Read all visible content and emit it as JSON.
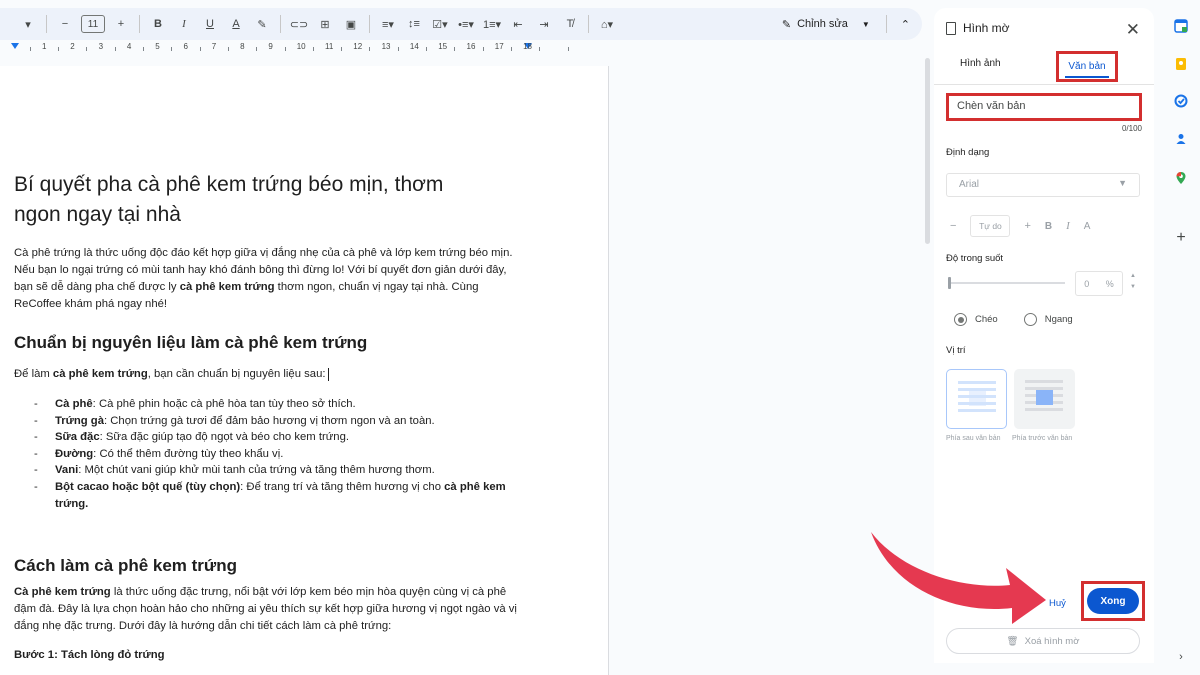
{
  "toolbar": {
    "font_size": "11",
    "edit_mode_label": "Chỉnh sửa"
  },
  "ruler": {
    "numbers": [
      "1",
      "2",
      "3",
      "4",
      "5",
      "6",
      "7",
      "8",
      "9",
      "10",
      "11",
      "12",
      "13",
      "14",
      "15",
      "16",
      "17",
      "18"
    ]
  },
  "document": {
    "title": "Bí quyết pha cà phê kem trứng béo mịn, thơm ngon ngay tại nhà",
    "intro_text": "Cà phê trứng là thức uống độc đáo kết hợp giữa vị đắng nhẹ của cà phê và lớp kem trứng béo mịn. Nếu bạn lo ngại trứng có mùi tanh hay khó đánh bông thì đừng lo! Với bí quyết đơn giản dưới đây, bạn sẽ dễ dàng pha chế được ly ",
    "intro_bold": "cà phê kem trứng",
    "intro_tail": " thơm ngon, chuẩn vị ngay tại nhà. Cùng ReCoffee khám phá ngay nhé!",
    "section1_heading": "Chuẩn bị nguyên liệu làm cà phê kem trứng",
    "section1_lead_pre": "Để làm ",
    "section1_lead_bold": "cà phê kem trứng",
    "section1_lead_post": ", bạn cần chuẩn bị nguyên liệu sau:",
    "ingredients": [
      {
        "name": "Cà phê",
        "desc": ": Cà phê phin hoặc cà phê hòa tan tùy theo sở thích."
      },
      {
        "name": "Trứng gà",
        "desc": ": Chọn trứng gà tươi để đảm bảo hương vị thơm ngon và an toàn."
      },
      {
        "name": "Sữa đặc",
        "desc": ": Sữa đặc giúp tạo độ ngọt và béo cho kem trứng."
      },
      {
        "name": "Đường",
        "desc": ": Có thể thêm đường tùy theo khẩu vị."
      },
      {
        "name": "Vani",
        "desc": ": Một chút vani giúp khử mùi tanh của trứng và tăng thêm hương thơm."
      },
      {
        "name": "Bột cacao hoặc bột quế (tùy chọn)",
        "desc": ": Để trang trí và tăng thêm hương vị cho ",
        "tail_bold": "cà phê kem trứng."
      }
    ],
    "section2_heading": "Cách làm cà phê kem trứng",
    "section2_bold": "Cà phê kem trứng",
    "section2_text": " là thức uống đặc trưng, nổi bật với lớp kem béo mịn hòa quyện cùng vị cà phê đậm đà. Đây là lựa chọn hoàn hảo cho những ai yêu thích sự kết hợp giữa hương vị ngọt ngào và vị đắng nhẹ đặc trưng. Dưới đây là hướng dẫn chi tiết cách làm cà phê trứng:",
    "step1": "Bước 1: Tách lòng đỏ trứng"
  },
  "panel": {
    "title": "Hình mờ",
    "tab_image": "Hình ảnh",
    "tab_text": "Văn bản",
    "text_placeholder": "Chèn văn bản",
    "char_count": "0/100",
    "format_label": "Định dạng",
    "font_value": "Arial",
    "size_placeholder": "Tự do",
    "bold": "B",
    "italic": "I",
    "color": "A",
    "opacity_label": "Độ trong suốt",
    "opacity_value": "0",
    "opacity_unit": "%",
    "opacity_fraction": 0,
    "orientation_diagonal": "Chéo",
    "orientation_horizontal": "Ngang",
    "position_label": "Vị trí",
    "behind_text": "Phía sau văn bản",
    "in_front_text": "Phía trước văn bản",
    "cancel": "Huỷ",
    "done": "Xong",
    "delete_watermark": "Xoá hình mờ"
  },
  "colors": {
    "accent": "#0b57d0",
    "highlight_frame": "#d32f2f",
    "arrow": "#e53950"
  }
}
